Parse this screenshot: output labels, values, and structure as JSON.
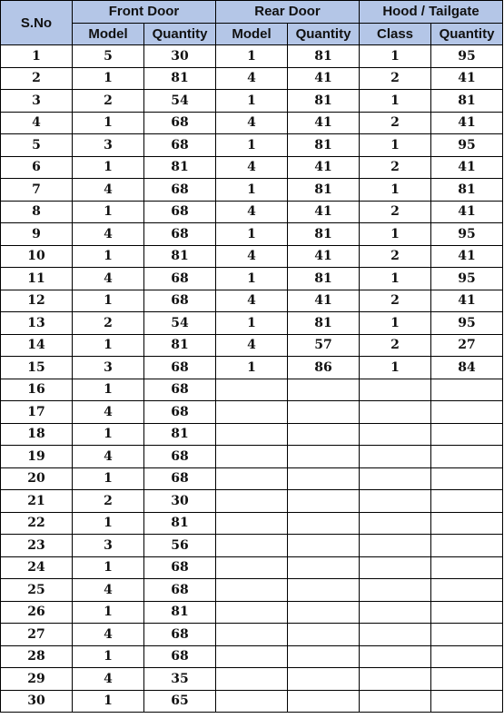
{
  "header": {
    "sno": "S.No",
    "groups": [
      "Front Door",
      "Rear Door",
      "Hood / Tailgate"
    ],
    "sub": [
      "Model",
      "Quantity",
      "Model",
      "Quantity",
      "Class",
      "Quantity"
    ]
  },
  "rows": [
    [
      "1",
      "5",
      "30",
      "1",
      "81",
      "1",
      "95"
    ],
    [
      "2",
      "1",
      "81",
      "4",
      "41",
      "2",
      "41"
    ],
    [
      "3",
      "2",
      "54",
      "1",
      "81",
      "1",
      "81"
    ],
    [
      "4",
      "1",
      "68",
      "4",
      "41",
      "2",
      "41"
    ],
    [
      "5",
      "3",
      "68",
      "1",
      "81",
      "1",
      "95"
    ],
    [
      "6",
      "1",
      "81",
      "4",
      "41",
      "2",
      "41"
    ],
    [
      "7",
      "4",
      "68",
      "1",
      "81",
      "1",
      "81"
    ],
    [
      "8",
      "1",
      "68",
      "4",
      "41",
      "2",
      "41"
    ],
    [
      "9",
      "4",
      "68",
      "1",
      "81",
      "1",
      "95"
    ],
    [
      "10",
      "1",
      "81",
      "4",
      "41",
      "2",
      "41"
    ],
    [
      "11",
      "4",
      "68",
      "1",
      "81",
      "1",
      "95"
    ],
    [
      "12",
      "1",
      "68",
      "4",
      "41",
      "2",
      "41"
    ],
    [
      "13",
      "2",
      "54",
      "1",
      "81",
      "1",
      "95"
    ],
    [
      "14",
      "1",
      "81",
      "4",
      "57",
      "2",
      "27"
    ],
    [
      "15",
      "3",
      "68",
      "1",
      "86",
      "1",
      "84"
    ],
    [
      "16",
      "1",
      "68",
      "",
      "",
      "",
      ""
    ],
    [
      "17",
      "4",
      "68",
      "",
      "",
      "",
      ""
    ],
    [
      "18",
      "1",
      "81",
      "",
      "",
      "",
      ""
    ],
    [
      "19",
      "4",
      "68",
      "",
      "",
      "",
      ""
    ],
    [
      "20",
      "1",
      "68",
      "",
      "",
      "",
      ""
    ],
    [
      "21",
      "2",
      "30",
      "",
      "",
      "",
      ""
    ],
    [
      "22",
      "1",
      "81",
      "",
      "",
      "",
      ""
    ],
    [
      "23",
      "3",
      "56",
      "",
      "",
      "",
      ""
    ],
    [
      "24",
      "1",
      "68",
      "",
      "",
      "",
      ""
    ],
    [
      "25",
      "4",
      "68",
      "",
      "",
      "",
      ""
    ],
    [
      "26",
      "1",
      "81",
      "",
      "",
      "",
      ""
    ],
    [
      "27",
      "4",
      "68",
      "",
      "",
      "",
      ""
    ],
    [
      "28",
      "1",
      "68",
      "",
      "",
      "",
      ""
    ],
    [
      "29",
      "4",
      "35",
      "",
      "",
      "",
      ""
    ],
    [
      "30",
      "1",
      "65",
      "",
      "",
      "",
      ""
    ]
  ]
}
